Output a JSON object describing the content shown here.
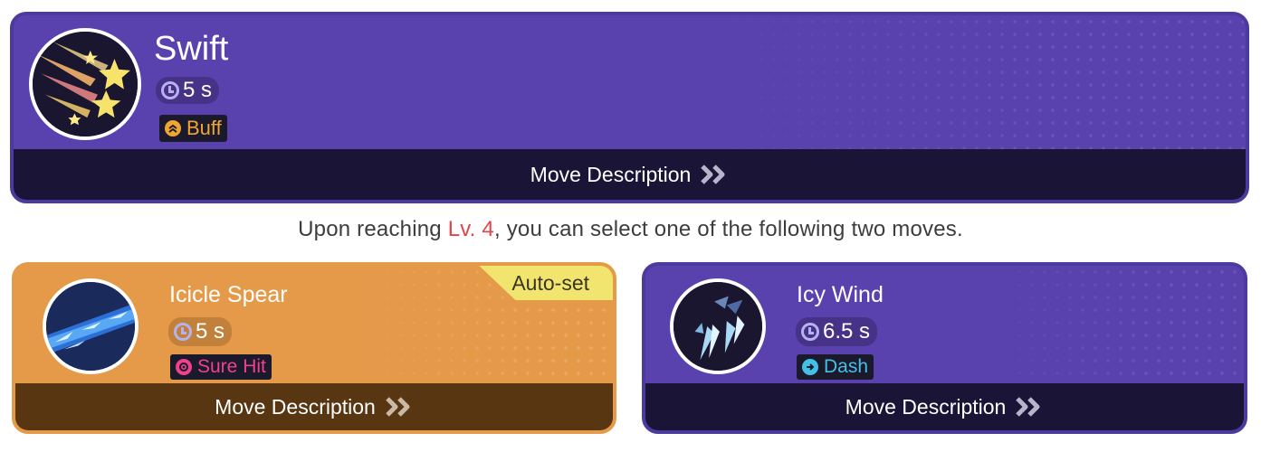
{
  "top_move": {
    "name": "Swift",
    "cooldown": "5 s",
    "tag": "Buff",
    "description_label": "Move Description"
  },
  "info_line": {
    "prefix": "Upon reaching ",
    "level": "Lv. 4",
    "suffix": ", you can select one of the following two moves."
  },
  "options": [
    {
      "name": "Icicle Spear",
      "cooldown": "5 s",
      "tag": "Sure Hit",
      "badge": "Auto-set",
      "description_label": "Move Description"
    },
    {
      "name": "Icy Wind",
      "cooldown": "6.5 s",
      "tag": "Dash",
      "description_label": "Move Description"
    }
  ],
  "colors": {
    "card_purple": "#5a42ae",
    "card_orange": "#e59a49",
    "bar_purple": "#1a1537",
    "bar_orange": "#583612",
    "tag_buff": "#f0a531",
    "tag_sure_hit": "#f0418a",
    "tag_dash": "#43c0e8",
    "auto_set_badge": "#f1e56f",
    "level_highlight": "#e0454a"
  },
  "icons": {
    "swift": "shooting-stars-icon",
    "icicle_spear": "ice-spear-icon",
    "icy_wind": "ice-shards-icon",
    "buff": "double-chevron-up-icon",
    "sure_hit": "target-icon",
    "dash": "arrow-right-icon",
    "cooldown": "clock-icon",
    "description": "double-chevron-right-icon"
  }
}
